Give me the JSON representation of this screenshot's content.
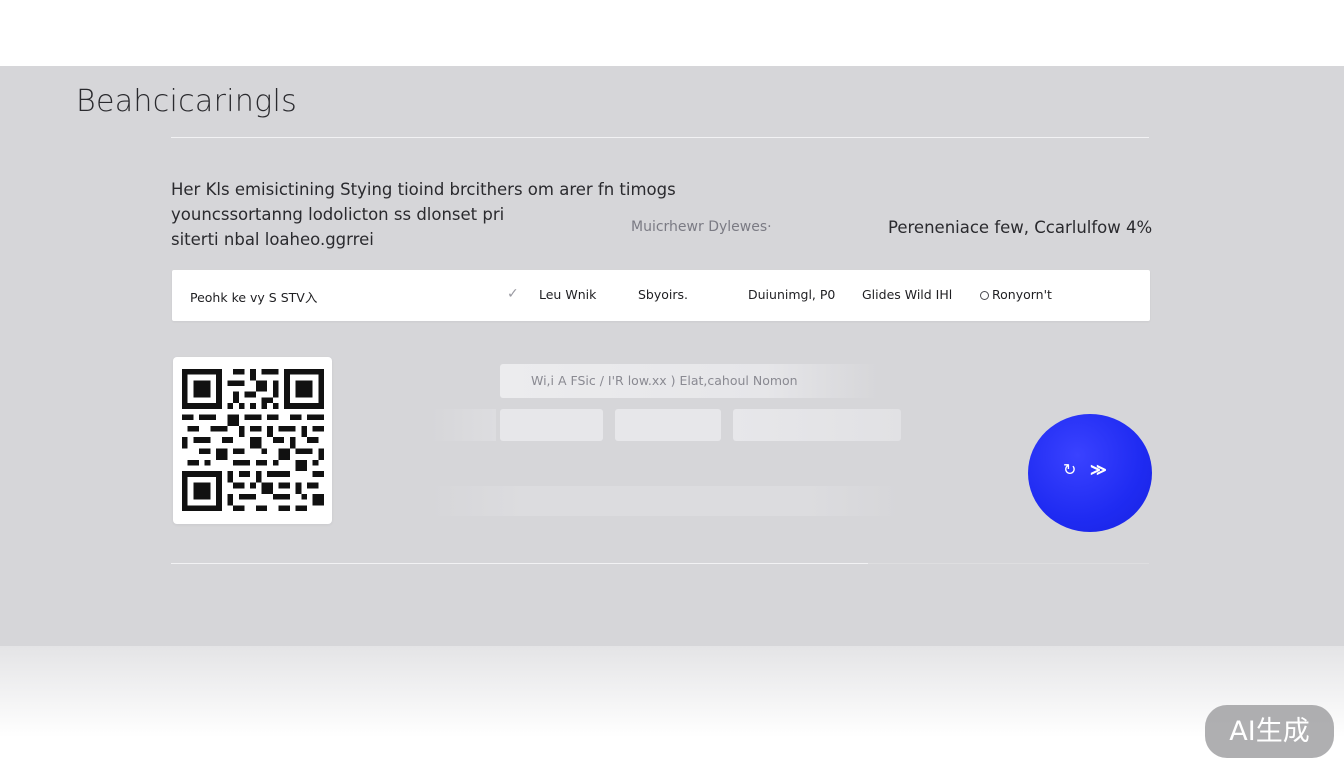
{
  "header": {
    "title": "Beahcicaringls"
  },
  "description": {
    "lines": [
      "Her Kls emisictining Stying tioind brcithers om arer fn timogs",
      "youncssortanng lodolicton ss dlonset pri",
      "siterti nbal loaheo.ggrrei"
    ]
  },
  "meta": {
    "center": "Muicrhewr Dylewes·",
    "right": "Pereneniace few, Ccarlulfow 4%"
  },
  "toolbar": {
    "path": "Peohk ke vy S  STV入",
    "check_glyph": "✓",
    "items": [
      "Leu  Wnik",
      "Sbyoirs.",
      "Duiunimgl,  P0",
      "Glides  Wild  IHl",
      "Ronyorn't"
    ]
  },
  "form": {
    "field_label": "Wi,i A FSic / I'R low.xx )  Elat,cahoul  Nomon"
  },
  "go_button": {
    "refresh_glyph": "↻",
    "forward_glyph": "≫"
  },
  "badge": {
    "label": "AI生成"
  },
  "colors": {
    "accent": "#1f2bf2",
    "panel": "#d6d6d9",
    "toolbar": "#ffffff"
  }
}
